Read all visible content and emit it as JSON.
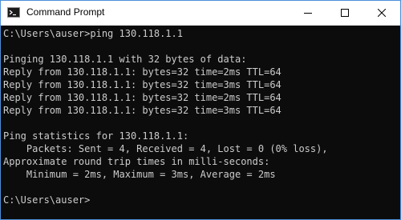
{
  "window": {
    "title": "Command Prompt",
    "app_icon": "cmd-icon",
    "controls": [
      "minimize-icon",
      "maximize-icon",
      "close-icon"
    ],
    "colors": {
      "console_background": "#0c0c0c",
      "console_text": "#cccccc",
      "titlebar_background": "#ffffff",
      "border": "#4a90d9"
    }
  },
  "console": {
    "lines": [
      "C:\\Users\\auser>ping 130.118.1.1",
      "",
      "Pinging 130.118.1.1 with 32 bytes of data:",
      "Reply from 130.118.1.1: bytes=32 time=2ms TTL=64",
      "Reply from 130.118.1.1: bytes=32 time=3ms TTL=64",
      "Reply from 130.118.1.1: bytes=32 time=2ms TTL=64",
      "Reply from 130.118.1.1: bytes=32 time=3ms TTL=64",
      "",
      "Ping statistics for 130.118.1.1:",
      "    Packets: Sent = 4, Received = 4, Lost = 0 (0% loss),",
      "Approximate round trip times in milli-seconds:",
      "    Minimum = 2ms, Maximum = 3ms, Average = 2ms",
      "",
      "C:\\Users\\auser>"
    ]
  }
}
